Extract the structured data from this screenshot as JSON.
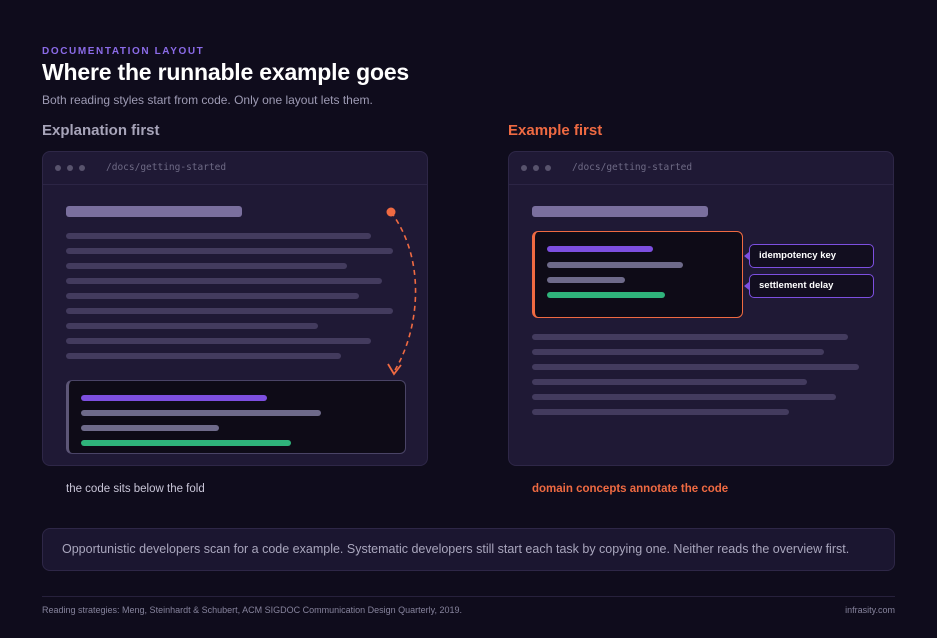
{
  "header": {
    "eyebrow": "DOCUMENTATION LAYOUT",
    "title": "Where the runnable example goes",
    "subtitle": "Both reading styles start from code. Only one layout lets them."
  },
  "left_panel": {
    "heading": "Explanation first",
    "url": "/docs/getting-started",
    "caption": "the code sits below the fold"
  },
  "right_panel": {
    "heading": "Example first",
    "url": "/docs/getting-started",
    "annotations": [
      "idempotency key",
      "settlement delay"
    ],
    "caption": "domain concepts annotate the code"
  },
  "callout": "Opportunistic developers scan for a code example. Systematic developers still start each task by copying one. Neither reads the overview first.",
  "footer": {
    "citation": "Reading strategies: Meng, Steinhardt & Schubert, ACM SIGDOC Communication Design Quarterly, 2019.",
    "brand": "infrasity.com"
  },
  "colors": {
    "background": "#0f0c1c",
    "accent_orange": "#ef6a42",
    "accent_purple": "#7d4fe0",
    "code_green": "#2fb37b"
  }
}
